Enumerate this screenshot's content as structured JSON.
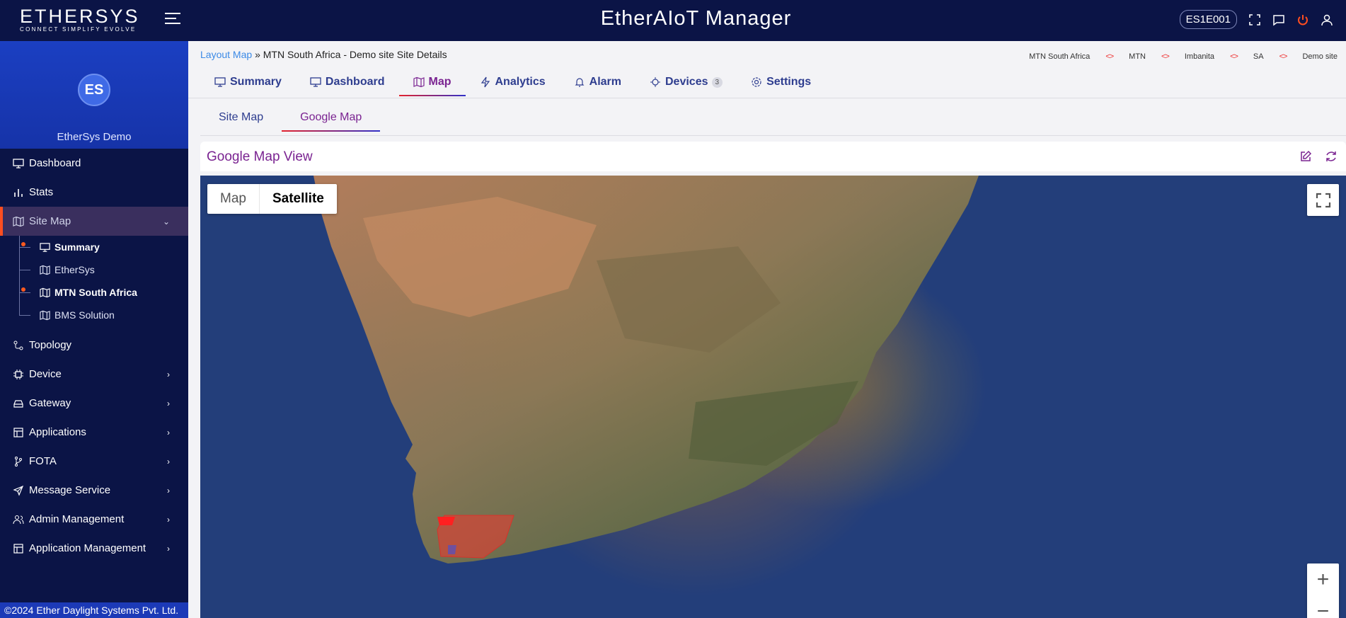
{
  "app": {
    "title": "EtherAIoT Manager",
    "device_id": "ES1E001"
  },
  "logo": {
    "brand": "ETHERSYS",
    "tagline": "CONNECT SIMPLIFY EVOLVE"
  },
  "profile": {
    "initials": "ES",
    "name": "EtherSys Demo"
  },
  "sidebar": {
    "items": [
      {
        "label": "Dashboard",
        "icon": "monitor-icon"
      },
      {
        "label": "Stats",
        "icon": "bar-chart-icon"
      },
      {
        "label": "Site Map",
        "icon": "map-icon",
        "active": true
      }
    ],
    "site_map_children": [
      {
        "label": "Summary",
        "icon": "monitor-icon"
      },
      {
        "label": "EtherSys",
        "icon": "map-icon"
      },
      {
        "label": "MTN South Africa",
        "icon": "map-icon"
      },
      {
        "label": "BMS Solution",
        "icon": "map-icon"
      }
    ],
    "items_after": [
      {
        "label": "Topology",
        "icon": "topology-icon"
      },
      {
        "label": "Device",
        "icon": "chip-icon"
      },
      {
        "label": "Gateway",
        "icon": "router-icon"
      },
      {
        "label": "Applications",
        "icon": "layout-icon"
      },
      {
        "label": "FOTA",
        "icon": "branch-icon"
      },
      {
        "label": "Message Service",
        "icon": "send-icon"
      },
      {
        "label": "Admin Management",
        "icon": "users-icon"
      },
      {
        "label": "Application Management",
        "icon": "layout-icon"
      }
    ],
    "footer": "©2024 Ether Daylight Systems Pvt. Ltd."
  },
  "breadcrumb": {
    "link": "Layout Map",
    "separator": "»",
    "current": "MTN South Africa - Demo site Site Details"
  },
  "hierarchy": [
    "MTN South Africa",
    "MTN",
    "Imbanita",
    "SA",
    "Demo site"
  ],
  "tabs": [
    {
      "label": "Summary",
      "icon": "monitor-icon"
    },
    {
      "label": "Dashboard",
      "icon": "monitor-icon"
    },
    {
      "label": "Map",
      "icon": "map-icon",
      "active": true
    },
    {
      "label": "Analytics",
      "icon": "bolt-icon"
    },
    {
      "label": "Alarm",
      "icon": "bell-icon"
    },
    {
      "label": "Devices",
      "icon": "chip-icon",
      "count": "3"
    },
    {
      "label": "Settings",
      "icon": "gear-icon"
    }
  ],
  "subtabs": [
    {
      "label": "Site Map"
    },
    {
      "label": "Google Map",
      "active": true
    }
  ],
  "card": {
    "title": "Google Map View"
  },
  "map": {
    "type_map": "Map",
    "type_satellite": "Satellite",
    "selected": "Satellite",
    "zoom_in": "+",
    "zoom_out": "−"
  }
}
